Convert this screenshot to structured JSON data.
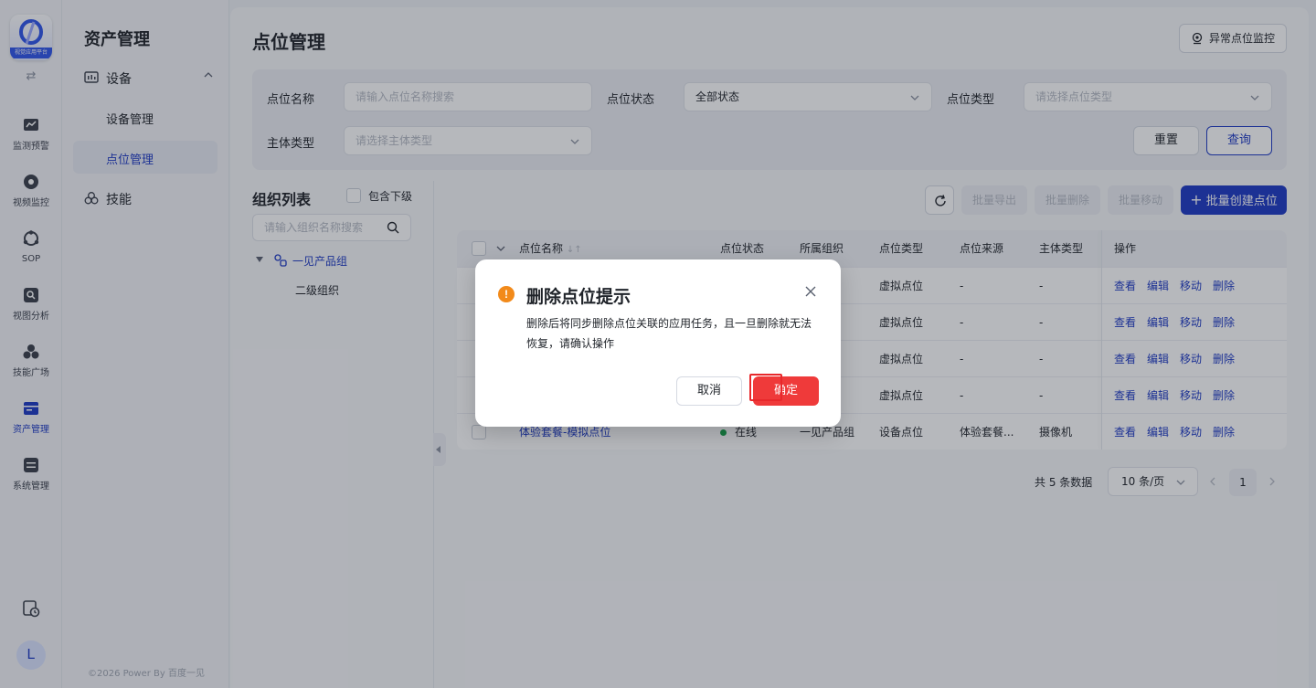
{
  "rail": {
    "logo_caption": "视觉应用平台",
    "items": [
      {
        "label": "监测预警",
        "icon": "chart-monitor-icon"
      },
      {
        "label": "视频监控",
        "icon": "camera-icon"
      },
      {
        "label": "SOP",
        "icon": "sop-icon"
      },
      {
        "label": "视图分析",
        "icon": "image-analysis-icon"
      },
      {
        "label": "技能广场",
        "icon": "skills-icon"
      },
      {
        "label": "资产管理",
        "icon": "asset-icon"
      },
      {
        "label": "系统管理",
        "icon": "system-icon"
      }
    ],
    "active_label": "资产管理",
    "avatar_letter": "L"
  },
  "sidebar": {
    "title": "资产管理",
    "group": "设备",
    "sub_items": [
      "设备管理",
      "点位管理"
    ],
    "active_sub": "点位管理",
    "skills": "技能",
    "footer": "©2026 Power By 百度一见"
  },
  "page": {
    "title": "点位管理",
    "top_button": "异常点位监控"
  },
  "filters": {
    "name_label": "点位名称",
    "name_placeholder": "请输入点位名称搜索",
    "status_label": "点位状态",
    "status_value": "全部状态",
    "type_label": "点位类型",
    "type_placeholder": "请选择点位类型",
    "subject_label": "主体类型",
    "subject_placeholder": "请选择主体类型",
    "reset": "重置",
    "query": "查询"
  },
  "org": {
    "title": "组织列表",
    "include_sub": "包含下级",
    "search_placeholder": "请输入组织名称搜索",
    "root": "一见产品组",
    "child": "二级组织"
  },
  "toolbar": {
    "export": "批量导出",
    "delete": "批量删除",
    "move": "批量移动",
    "create": "批量创建点位"
  },
  "table": {
    "headers": [
      "点位名称",
      "点位状态",
      "所属组织",
      "点位类型",
      "点位来源",
      "主体类型",
      "操作"
    ],
    "rows": [
      {
        "name": "",
        "status": "",
        "org": "品组",
        "type": "虚拟点位",
        "source": "-",
        "subject": "-"
      },
      {
        "name": "",
        "status": "",
        "org": "品组",
        "type": "虚拟点位",
        "source": "-",
        "subject": "-"
      },
      {
        "name": "",
        "status": "",
        "org": "品组",
        "type": "虚拟点位",
        "source": "-",
        "subject": "-"
      },
      {
        "name": "",
        "status": "",
        "org": "品组",
        "type": "虚拟点位",
        "source": "-",
        "subject": "-"
      },
      {
        "name": "体验套餐-模拟点位",
        "status": "在线",
        "org": "一见产品组",
        "type": "设备点位",
        "source": "体验套餐...",
        "subject": "摄像机"
      }
    ],
    "ops": [
      "查看",
      "编辑",
      "移动",
      "删除"
    ]
  },
  "pagination": {
    "total": "共 5 条数据",
    "page_size": "10 条/页",
    "current": "1"
  },
  "modal": {
    "title": "删除点位提示",
    "message": "删除后将同步删除点位关联的应用任务，且一旦删除就无法恢复，请确认操作",
    "cancel": "取消",
    "confirm": "确定",
    "warn_symbol": "!"
  },
  "colors": {
    "primary": "#1d39c4",
    "danger": "#ef3a3a",
    "warning": "#f28a1a",
    "online": "#17a34a"
  }
}
